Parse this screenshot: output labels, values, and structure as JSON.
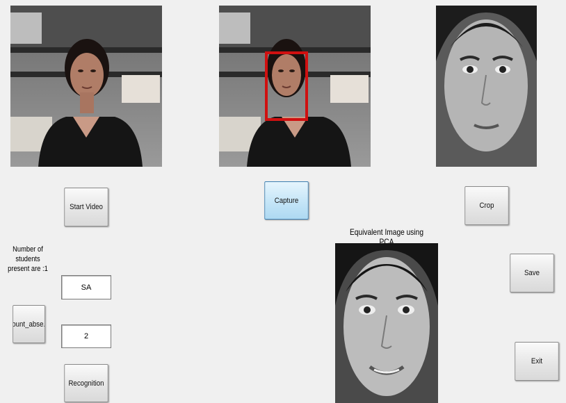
{
  "axes": {
    "live_video": "live-video-frame",
    "captured_frame": "captured-frame-with-face-box",
    "cropped_face": "cropped-face-image",
    "pca_face": "pca-equivalent-face-image"
  },
  "buttons": {
    "start_video": "Start Video",
    "capture": "Capture",
    "crop": "Crop",
    "save": "Save",
    "exit": "Exit",
    "count_absent": "count_abse...",
    "recognition": "Recognition"
  },
  "labels": {
    "students_present": "Number of students present are :1",
    "pca_title": "Equivalent Image using PCA"
  },
  "fields": {
    "name_value": "SA",
    "count_value": "2"
  },
  "colors": {
    "window_bg": "#f0f0f0",
    "face_box": "#d01010",
    "focused_button": "#c4e5f7"
  }
}
